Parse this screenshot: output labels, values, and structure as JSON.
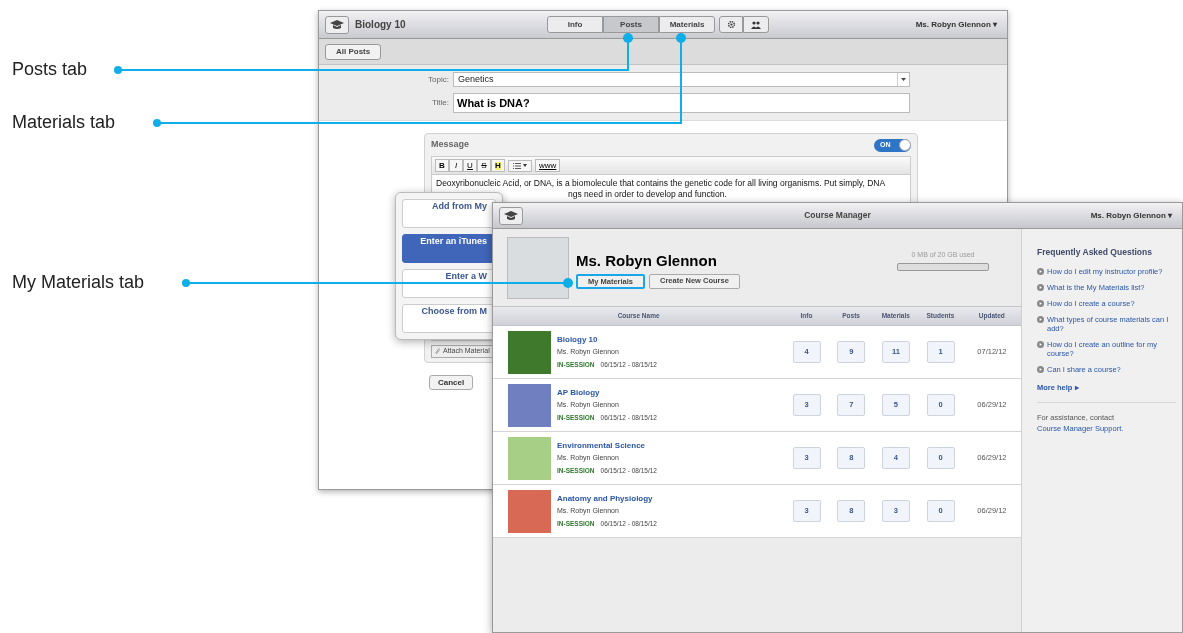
{
  "callouts": [
    {
      "label": "Posts tab"
    },
    {
      "label": "Materials tab"
    },
    {
      "label": "My Materials tab"
    }
  ],
  "post_window": {
    "course": "Biology 10",
    "tabs": [
      {
        "label": "Info",
        "selected": false
      },
      {
        "label": "Posts",
        "selected": true
      },
      {
        "label": "Materials",
        "selected": false
      }
    ],
    "user": "Ms. Robyn Glennon ▾",
    "back_button": "All Posts",
    "topic": {
      "label": "Topic:",
      "value": "Genetics"
    },
    "title": {
      "label": "Title:",
      "value": "What is DNA?"
    },
    "message": {
      "label": "Message",
      "switch": {
        "label": "ON",
        "on": true
      },
      "format_buttons": [
        {
          "label": "B",
          "kind": "bold"
        },
        {
          "label": "I",
          "kind": "italic"
        },
        {
          "label": "U",
          "kind": "underline"
        },
        {
          "label": "S",
          "kind": "strike"
        },
        {
          "label": "H",
          "kind": "highlight"
        }
      ],
      "link_button": "www",
      "lines": [
        "Deoxyribonucleic Acid, or DNA, is a biomolecule that contains the genetic code for all living organisms. Put simply, DNA",
        "ngs need in order to develop and function."
      ]
    },
    "attach_button": "Attach Material",
    "cancel_button": "Cancel"
  },
  "popover": {
    "items": [
      {
        "label": "Add from My",
        "selected": false
      },
      {
        "label": "Enter an iTunes",
        "selected": true
      },
      {
        "label": "Enter a W",
        "selected": false
      },
      {
        "label": "Choose from M",
        "selected": false
      }
    ]
  },
  "manager": {
    "title": "Course Manager",
    "user": "Ms. Robyn Glennon ▾",
    "profile_name": "Ms. Robyn Glennon",
    "buttons": [
      {
        "label": "My Materials",
        "highlighted": true
      },
      {
        "label": "Create New Course",
        "highlighted": false
      }
    ],
    "storage": {
      "text": "0 MB of 20 GB used"
    },
    "columns": [
      "Course Name",
      "Info",
      "Posts",
      "Materials",
      "Students",
      "Updated"
    ],
    "rows": [
      {
        "name": "Biology 10",
        "teacher": "Ms. Robyn Glennon",
        "status": "IN-SESSION",
        "dates": "06/15/12 - 08/15/12",
        "info": "4",
        "posts": "9",
        "materials": "11",
        "students": "1",
        "updated": "07/12/12"
      },
      {
        "name": "AP Biology",
        "teacher": "Ms. Robyn Glennon",
        "status": "IN-SESSION",
        "dates": "06/15/12 - 08/15/12",
        "info": "3",
        "posts": "7",
        "materials": "5",
        "students": "0",
        "updated": "06/29/12"
      },
      {
        "name": "Environmental Science",
        "teacher": "Ms. Robyn Glennon",
        "status": "IN-SESSION",
        "dates": "06/15/12 - 08/15/12",
        "info": "3",
        "posts": "8",
        "materials": "4",
        "students": "0",
        "updated": "06/29/12"
      },
      {
        "name": "Anatomy and Physiology",
        "teacher": "Ms. Robyn Glennon",
        "status": "IN-SESSION",
        "dates": "06/15/12 - 08/15/12",
        "info": "3",
        "posts": "8",
        "materials": "3",
        "students": "0",
        "updated": "06/29/12"
      }
    ],
    "faq": {
      "title": "Frequently Asked Questions",
      "items": [
        "How do I edit my instructor profile?",
        "What is the My Materials list?",
        "How do I create a course?",
        "What types of course materials can I add?",
        "How do I create an outline for my course?",
        "Can I share a course?"
      ],
      "more_help": "More help ▸",
      "assistance": "For assistance, contact",
      "support_link": "Course Manager Support."
    }
  }
}
